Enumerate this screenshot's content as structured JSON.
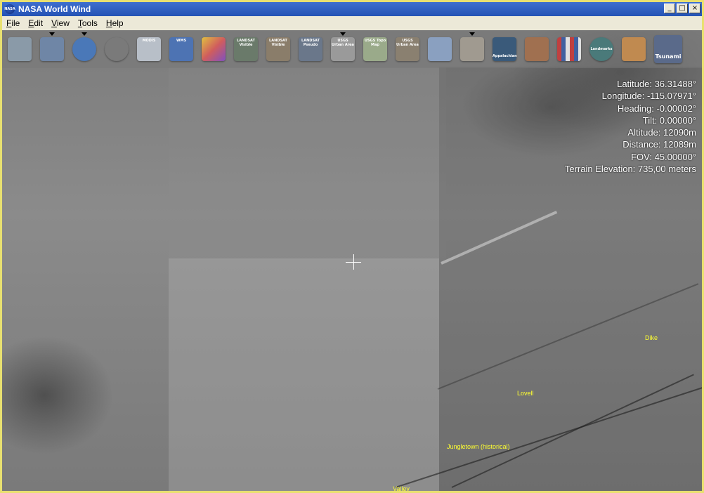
{
  "window": {
    "title": "NASA World Wind"
  },
  "menu": [
    {
      "label": "File",
      "key": "F",
      "rest": "ile"
    },
    {
      "label": "Edit",
      "key": "E",
      "rest": "dit"
    },
    {
      "label": "View",
      "key": "V",
      "rest": "iew"
    },
    {
      "label": "Tools",
      "key": "T",
      "rest": "ools"
    },
    {
      "label": "Help",
      "key": "H",
      "rest": "elp"
    }
  ],
  "toolbar": {
    "items": [
      {
        "name": "layer-manager-icon",
        "label": "",
        "color": "#8a9aa8"
      },
      {
        "name": "lat-lon-grid-icon",
        "label": "",
        "color": "#6f86a6"
      },
      {
        "name": "globe-icon",
        "label": "",
        "color": "#4a78b8"
      },
      {
        "name": "place-finder-icon",
        "label": "",
        "color": "#7a7a7a"
      },
      {
        "name": "modis-icon",
        "label": "MODIS",
        "color": "#b8bfc8"
      },
      {
        "name": "wms-icon",
        "label": "WMS",
        "color": "#4d73b3"
      },
      {
        "name": "scientific-visualization-icon",
        "label": "",
        "color": "#d05d5d"
      },
      {
        "name": "landsat-visible-icon",
        "label": "LANDSAT Visible",
        "color": "#6a7a6a"
      },
      {
        "name": "landsat-visible-2-icon",
        "label": "LANDSAT Visible",
        "color": "#8a7d6a"
      },
      {
        "name": "landsat-pseudo-icon",
        "label": "LANDSAT Pseudo",
        "color": "#6a778a"
      },
      {
        "name": "usgs-urban-area-icon",
        "label": "USGS Urban Area",
        "color": "#9a9a9a"
      },
      {
        "name": "usgs-topo-map-icon",
        "label": "USGS Topo Map",
        "color": "#9aaa8a"
      },
      {
        "name": "usgs-urban-area-2-icon",
        "label": "USGS Urban Area",
        "color": "#8a8070"
      },
      {
        "name": "blue-marble-icon",
        "label": "",
        "color": "#8aa0c0"
      },
      {
        "name": "boundaries-icon",
        "label": "",
        "color": "#a09a90"
      },
      {
        "name": "appalachian-icon",
        "label": "Appalachian",
        "color": "#3a5a7a"
      },
      {
        "name": "landsat-history-icon",
        "label": "",
        "color": "#a07050"
      },
      {
        "name": "flags-icon",
        "label": "",
        "color": "#8a6a6a"
      },
      {
        "name": "landmarks-icon",
        "label": "Landmarks",
        "color": "#4a7a7a"
      },
      {
        "name": "usa-map-icon",
        "label": "",
        "color": "#c08a50"
      },
      {
        "name": "tsunami-icon",
        "label": "Tsunami",
        "color": "#5a6a8a"
      }
    ]
  },
  "status": {
    "latitude": "Latitude: 36.31488°",
    "longitude": "Longitude: -115.07971°",
    "heading": "Heading: -0.00002°",
    "tilt": "Tilt: 0.00000°",
    "altitude": "Altitude: 12090m",
    "distance": "Distance: 12089m",
    "fov": "FOV: 45.00000°",
    "terrain": "Terrain Elevation: 735,00 meters"
  },
  "places": {
    "dike": "Dike",
    "lovell": "Lovell",
    "jungletown": "Jungletown (historical)",
    "valley": "Valley"
  }
}
